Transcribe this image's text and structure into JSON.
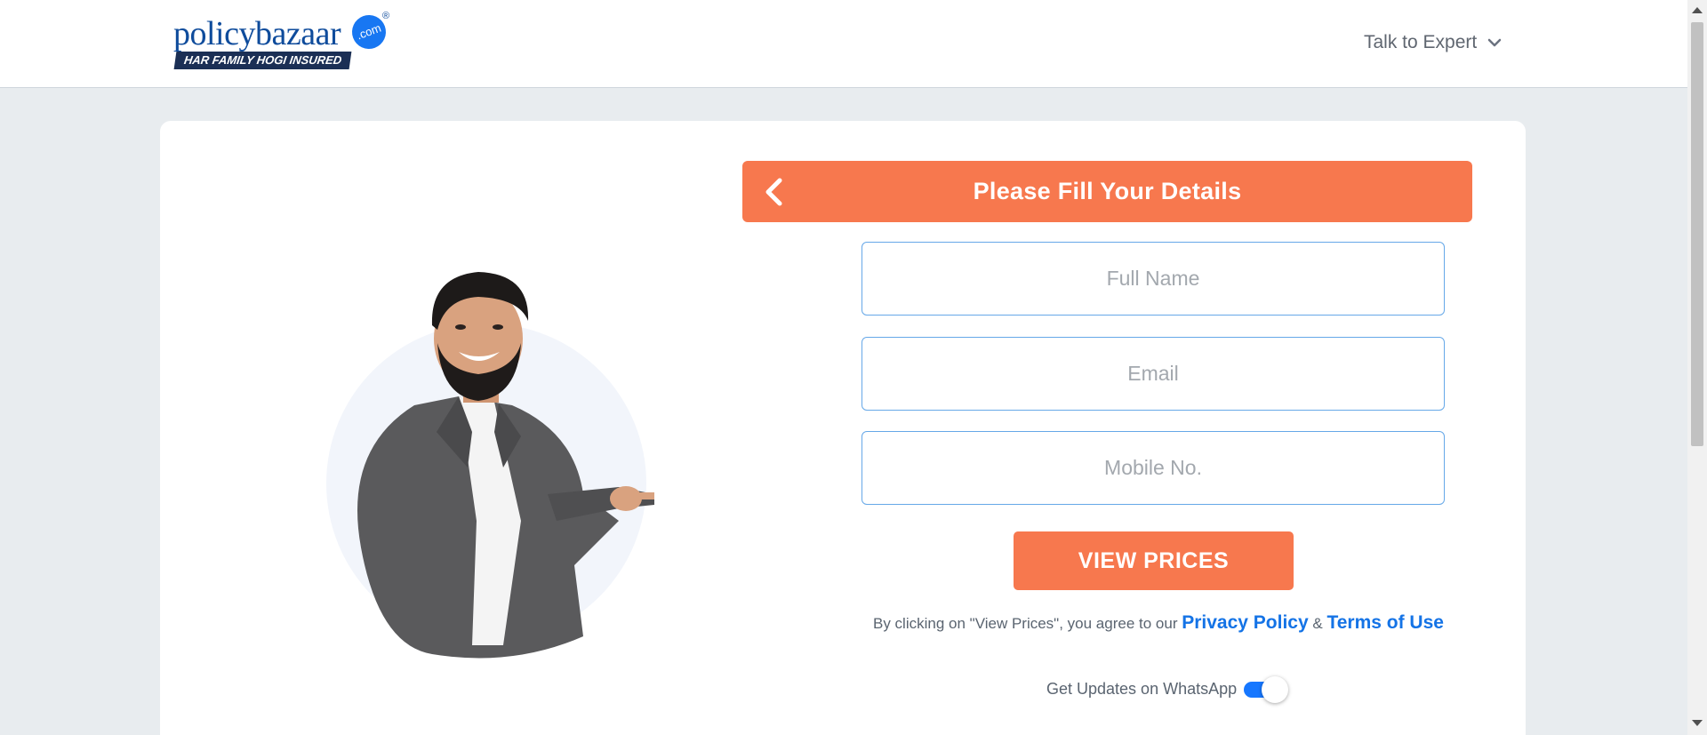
{
  "header": {
    "logo_word_policy": "policy",
    "logo_word_bazaar": "bazaar",
    "logo_dot": ".com",
    "logo_reg": "®",
    "logo_tagline": "HAR FAMILY HOGI INSURED",
    "talk_to_expert": "Talk to Expert"
  },
  "form": {
    "title": "Please Fill Your Details",
    "full_name_placeholder": "Full Name",
    "email_placeholder": "Email",
    "mobile_placeholder": "Mobile No.",
    "view_prices_label": "VIEW PRICES",
    "terms_prefix": "By clicking on \"View Prices\", you agree to our",
    "privacy_link": "Privacy Policy",
    "amp": "&",
    "terms_link": "Terms of Use",
    "whatsapp_label": "Get Updates on WhatsApp",
    "whatsapp_on": true
  },
  "colors": {
    "accent_orange": "#f7784e",
    "link_blue": "#1473e6",
    "toggle_blue": "#1677ff",
    "brand_navy": "#0f4c9c"
  },
  "icons": {
    "back": "chevron-left-icon",
    "talk_dropdown": "chevron-down-icon"
  }
}
